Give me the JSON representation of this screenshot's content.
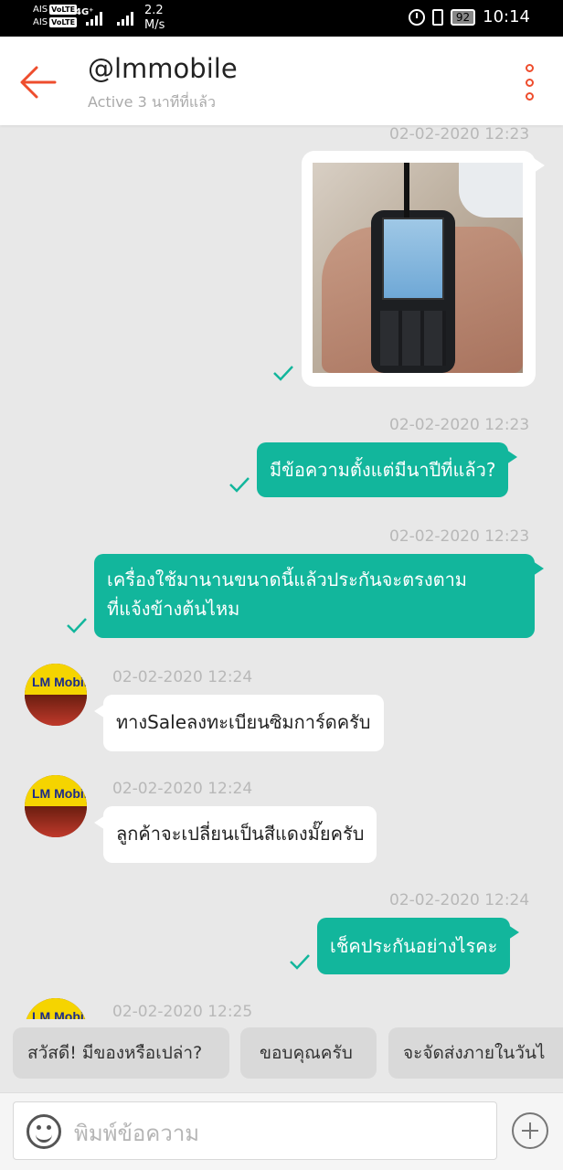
{
  "status_bar": {
    "carrier1": "AIS",
    "carrier2": "AIS",
    "volte": "VoLTE",
    "network": "4G⁺",
    "speed_value": "2.2",
    "speed_unit": "M/s",
    "battery": "92",
    "clock": "10:14"
  },
  "header": {
    "title": "@lmmobile",
    "subtitle": "Active 3 นาทีที่แล้ว"
  },
  "messages": [
    {
      "type": "image",
      "time": "02-02-2020 12:23"
    },
    {
      "type": "out",
      "time": "02-02-2020 12:23",
      "text": "มีข้อความตั้งแต่มีนาปีที่แล้ว?"
    },
    {
      "type": "out",
      "time": "02-02-2020 12:23",
      "line1": "เครื่องใช้มานานขนาดนี้แล้วประกันจะตรงตาม",
      "line2": "ที่แจ้งข้างต้นไหม"
    },
    {
      "type": "in",
      "time": "02-02-2020 12:24",
      "text": "ทางSaleลงทะเบียนซิมการ์ดครับ"
    },
    {
      "type": "in",
      "time": "02-02-2020 12:24",
      "text": "ลูกค้าจะเปลี่ยนเป็นสีแดงมั๊ยครับ"
    },
    {
      "type": "out",
      "time": "02-02-2020 12:24",
      "text": "เช็คประกันอย่างไรคะ"
    },
    {
      "type": "in",
      "time": "02-02-2020 12:25"
    }
  ],
  "avatar_text": "LM Mobile",
  "quick_replies": [
    "สวัสดี! มีของหรือเปล่า?",
    "ขอบคุณครับ",
    "จะจัดส่งภายในวันไ"
  ],
  "input": {
    "placeholder": "พิมพ์ข้อความ"
  },
  "colors": {
    "accent": "#ee4d2d",
    "bubble_out": "#12b69c"
  }
}
